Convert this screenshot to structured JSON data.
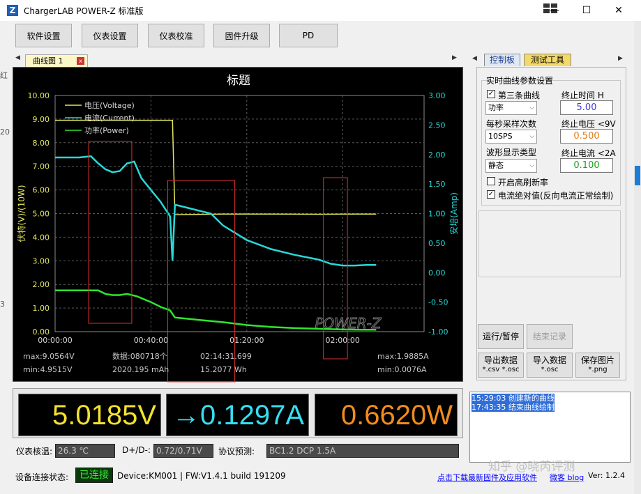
{
  "window": {
    "title": "ChargerLAB POWER-Z 标准版",
    "logo_letter": "Z",
    "minimize": "—",
    "maximize": "☐",
    "close": "✕"
  },
  "toolbar": [
    "软件设置",
    "仪表设置",
    "仪表校准",
    "固件升级",
    "PD"
  ],
  "chart_tab": {
    "label": "曲线图 1",
    "close": "x"
  },
  "chart_data": {
    "type": "line",
    "title": "标题",
    "left_axis_label": "伏特(V)/(10W)",
    "right_axis_label": "安培(Amp)",
    "left_ticks": [
      "10.00",
      "9.00",
      "8.00",
      "7.00",
      "6.00",
      "5.00",
      "4.00",
      "3.00",
      "2.00",
      "1.00",
      "0.00"
    ],
    "right_ticks": [
      "3.00",
      "2.50",
      "2.00",
      "1.50",
      "1.00",
      "0.50",
      "0.00",
      "-0.50",
      "-1.00"
    ],
    "x_ticks": [
      "00:00:00",
      "00:40:00",
      "01:20:00",
      "02:00:00"
    ],
    "left_range": [
      0,
      10
    ],
    "right_range": [
      -1,
      3
    ],
    "legend": [
      "电压(Voltage)",
      "电流(Current)",
      "功率(Power)"
    ],
    "series_colors": {
      "voltage": "#e6e65c",
      "current": "#28d8d8",
      "power": "#2ee62e"
    },
    "series": [
      {
        "name": "电压(Voltage)",
        "axis": "left",
        "x_min": [
          0,
          20,
          40,
          49,
          50,
          70,
          90,
          110,
          130,
          134
        ],
        "values": [
          8.95,
          8.95,
          8.95,
          8.95,
          4.95,
          4.98,
          4.98,
          4.97,
          4.98,
          4.98
        ]
      },
      {
        "name": "电流(Current)",
        "axis": "right",
        "x_min": [
          0,
          10,
          15,
          18,
          21,
          24,
          27,
          30,
          33,
          36,
          40,
          44,
          48,
          49,
          50,
          55,
          60,
          65,
          70,
          80,
          90,
          100,
          110,
          115,
          120,
          125,
          130,
          134
        ],
        "values": [
          1.95,
          1.95,
          1.97,
          1.85,
          1.75,
          1.7,
          1.72,
          1.85,
          1.88,
          1.6,
          1.4,
          1.2,
          0.95,
          0.2,
          1.15,
          1.1,
          1.05,
          1.0,
          0.8,
          0.55,
          0.4,
          0.3,
          0.22,
          0.15,
          0.12,
          0.12,
          0.13,
          0.13
        ]
      },
      {
        "name": "功率(Power)",
        "axis": "left",
        "x_min": [
          0,
          10,
          18,
          21,
          24,
          27,
          30,
          34,
          40,
          44,
          48,
          50,
          60,
          70,
          80,
          90,
          100,
          110,
          120,
          130,
          134
        ],
        "values": [
          1.75,
          1.75,
          1.75,
          1.6,
          1.55,
          1.55,
          1.6,
          1.5,
          1.25,
          1.05,
          0.9,
          0.6,
          0.5,
          0.4,
          0.28,
          0.2,
          0.15,
          0.12,
          0.09,
          0.08,
          0.08
        ]
      }
    ],
    "highlight_boxes_min": [
      [
        14,
        32
      ],
      [
        47,
        75
      ],
      [
        112,
        122
      ]
    ],
    "logo": "POWER-Z",
    "stats": {
      "max_v": "max:9.0564V",
      "min_v": "min:4.9515V",
      "count": "数据:080718个",
      "mah": "2020.195 mAh",
      "elapsed": "02:14:31.699",
      "wh": "15.2077 Wh",
      "max_a": "max:1.9885A",
      "min_a": "min:0.0076A"
    }
  },
  "readouts": {
    "voltage": "5.0185V",
    "current": "→0.1297A",
    "power": "0.6620W"
  },
  "info": {
    "temp_label": "仪表核温:",
    "temp_value": "26.3 ℃",
    "dpdm_label": "D+/D-:",
    "dpdm_value": "0.72/0.71V",
    "proto_label": "协议预测:",
    "proto_value": "BC1.2 DCP 1.5A"
  },
  "status": {
    "conn_label": "设备连接状态:",
    "connected": "已连接",
    "device": "Device:KM001 | FW:V1.4.1 build 191209",
    "download_link": "点击下载最新固件及应用软件",
    "blog_link": "微客 blog",
    "version": "Ver: 1.2.4"
  },
  "right_panel": {
    "tab_control": "控制板",
    "tab_test": "测试工具",
    "group_title": "实时曲线参数设置",
    "third_curve_label": "第三条曲线",
    "third_curve_checked": "✓",
    "third_curve_value": "功率",
    "end_time_label": "终止时间 H",
    "end_time_value": "5.00",
    "sps_label": "每秒采样次数",
    "sps_value": "10SPS",
    "end_voltage_label": "终止电压 <9V",
    "end_voltage_value": "0.500",
    "wave_label": "波形显示类型",
    "wave_value": "静态",
    "end_current_label": "终止电流 <2A",
    "end_current_value": "0.100",
    "high_refresh_label": "开启高刷新率",
    "abs_current_label": "电流绝对值(反向电流正常绘制)",
    "abs_current_checked": "✓",
    "run_pause": "运行/暂停",
    "end_record": "结束记录",
    "export_title": "导出数据",
    "export_sub": "*.csv *.osc",
    "import_title": "导入数据",
    "import_sub": "*.osc",
    "save_title": "保存图片",
    "save_sub": "*.png"
  },
  "log": [
    "15:29:03 创建新的曲线",
    "17:43:35 结束曲线绘制"
  ],
  "watermark": "知乎 @晓芮评测",
  "edge_text": [
    "红",
    "20",
    "3"
  ]
}
